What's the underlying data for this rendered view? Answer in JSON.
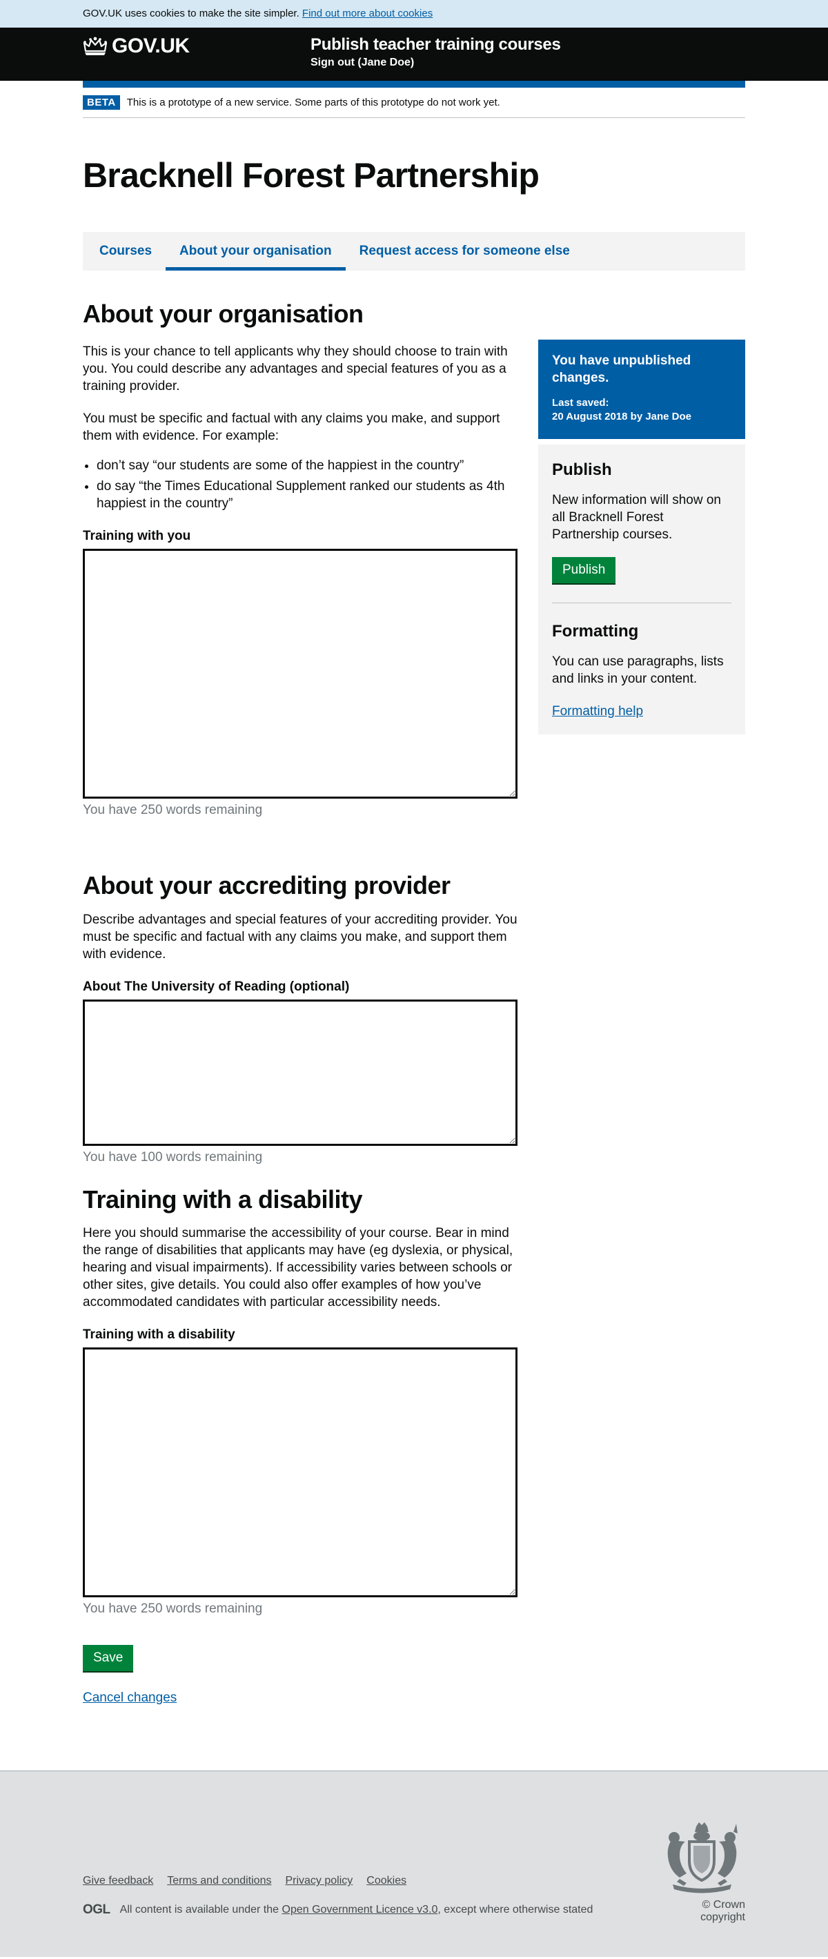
{
  "cookie": {
    "text": "GOV.UK uses cookies to make the site simpler.",
    "link": "Find out more about cookies"
  },
  "header": {
    "logo": "GOV.UK",
    "service_name": "Publish teacher training courses",
    "signout": "Sign out (Jane Doe)",
    "brand_color": "#005ea5"
  },
  "phase": {
    "tag": "BETA",
    "text": "This is a prototype of a new service. Some parts of this prototype do not work yet."
  },
  "page_title": "Bracknell Forest Partnership",
  "tabs": [
    {
      "label": "Courses",
      "active": false
    },
    {
      "label": "About your organisation",
      "active": true
    },
    {
      "label": "Request access for someone else",
      "active": false
    }
  ],
  "about": {
    "heading": "About your organisation",
    "intro": "This is your chance to tell applicants why they should choose to train with you. You could describe any advantages and special features of you as a training provider.",
    "guidance": "You must be specific and factual with any claims you make, and support them with evidence. For example:",
    "examples": [
      "don’t say “our students are some of the happiest in the country”",
      "do say “the Times Educational Supplement ranked our students as 4th happiest in the country”"
    ],
    "field_label": "Training with you",
    "field_value": "",
    "hint": "You have 250 words remaining"
  },
  "accrediting": {
    "heading": "About your accrediting provider",
    "intro": "Describe advantages and special features of your accrediting provider. You must be specific and factual with any claims you make, and support them with evidence.",
    "field_label": "About The University of Reading (optional)",
    "field_value": "",
    "hint": "You have 100 words remaining"
  },
  "disability": {
    "heading": "Training with a disability",
    "intro": "Here you should summarise the accessibility of your course. Bear in mind the range of disabilities that applicants may have (eg dyslexia, or physical, hearing and visual impairments). If accessibility varies between schools or other sites, give details. You could also offer examples of how you’ve accommodated candidates with particular accessibility needs.",
    "field_label": "Training with a disability",
    "field_value": "",
    "hint": "You have 250 words remaining"
  },
  "actions": {
    "save": "Save",
    "cancel": "Cancel changes",
    "button_color": "#00823b"
  },
  "sidebar": {
    "notice_title": "You have unpublished changes.",
    "saved_label": "Last saved:",
    "saved_value": "20 August 2018 by Jane Doe",
    "publish_heading": "Publish",
    "publish_text": "New information will show on all Bracknell Forest Partnership courses.",
    "publish_button": "Publish",
    "formatting_heading": "Formatting",
    "formatting_text": "You can use paragraphs, lists and links in your content.",
    "formatting_link": "Formatting help"
  },
  "footer": {
    "links": [
      "Give feedback",
      "Terms and conditions",
      "Privacy policy",
      "Cookies"
    ],
    "ogl": "OGL",
    "licence_prefix": "All content is available under the",
    "licence_link": "Open Government Licence v3.0",
    "licence_suffix": ", except where otherwise stated",
    "copyright": "© Crown copyright"
  }
}
